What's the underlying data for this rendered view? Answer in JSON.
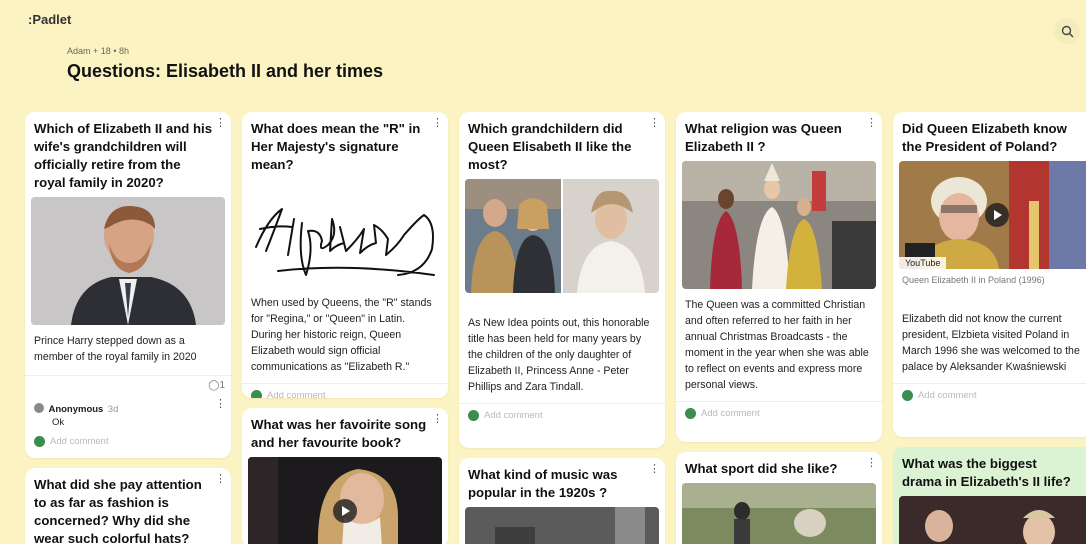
{
  "header": {
    "logo": ":Padlet",
    "author": "Adam",
    "plus": "+ 18",
    "time": "• 8h",
    "title": "Questions: Elisabeth II and her times"
  },
  "columns": [
    {
      "cards": [
        {
          "title": "Which of Elizabeth II and his wife's grandchildren will officially retire from the royal family in 2020?",
          "body": "Prince Harry stepped down as a member of the royal family in 2020",
          "comment_count": "1",
          "comment_author": "Anonymous",
          "comment_time": "3d",
          "comment_text": "Ok",
          "add_comment": "Add comment"
        },
        {
          "title": "What did she pay attention to as far as fashion is concerned? Why did she wear such colorful hats? What was"
        }
      ]
    },
    {
      "cards": [
        {
          "title": "What does mean the \"R\" in Her Majesty's signature mean?",
          "signature": "Elizabeth R",
          "body": "When used by Queens, the \"R\" stands for \"Regina,\" or \"Queen\" in Latin. During her historic reign, Queen Elizabeth would sign official communications as \"Elizabeth R.\"",
          "add_comment": "Add comment"
        },
        {
          "title": "What was her favoirite song and her favourite book?"
        }
      ]
    },
    {
      "cards": [
        {
          "title": "Which grandchildern did Queen Elisabeth II like the most?",
          "body": "As New Idea points out, this honorable title has been held for many years by the children of the only daughter of Elizabeth II, Princess Anne - Peter Phillips and Zara Tindall.",
          "add_comment": "Add comment"
        },
        {
          "title": "What kind of music was popular in the 1920s ?"
        }
      ]
    },
    {
      "cards": [
        {
          "title": "What religion was Queen Elizabeth II ?",
          "body": "The Queen was a committed Christian and often referred to her faith in her annual Christmas Broadcasts - the moment in the year when she was able to reflect on events and express more personal views.",
          "add_comment": "Add comment"
        },
        {
          "title": "What sport did she like?"
        }
      ]
    },
    {
      "cards": [
        {
          "title": "Did Queen Elizabeth know the President of Poland?",
          "video_source": "YouTube",
          "video_title": "Queen Elizabeth II in Poland (1996)",
          "body": "Elizabeth did not know the current president, Elzbieta visited Poland in March 1996 she was welcomed to the palace by Aleksander Kwaśniewski",
          "add_comment": "Add comment"
        },
        {
          "title": "What was the biggest drama in Elizabeth's II life?"
        }
      ]
    }
  ]
}
